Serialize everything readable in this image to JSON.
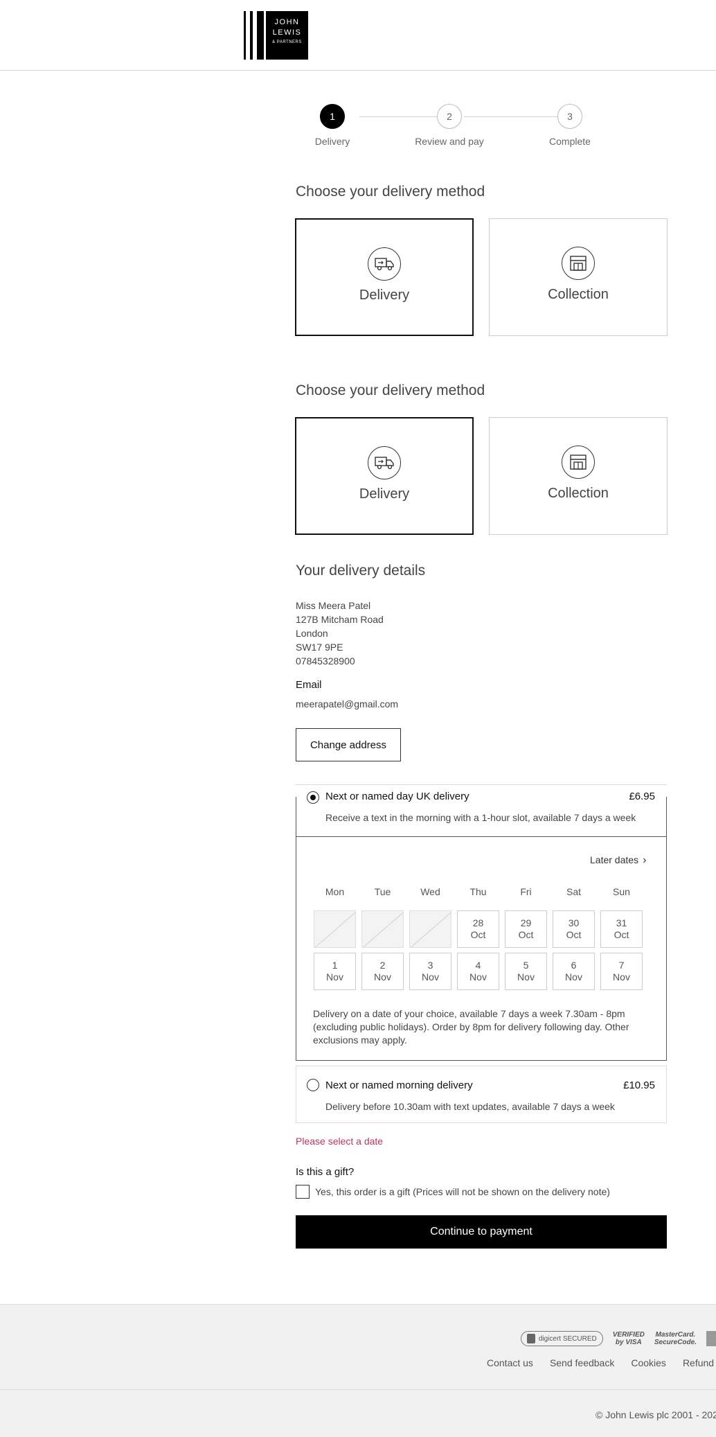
{
  "brand": {
    "line1": "JOHN",
    "line2": "LEWIS",
    "line3": "& PARTNERS"
  },
  "stepper": {
    "steps": [
      {
        "number": "1",
        "label": "Delivery",
        "active": true
      },
      {
        "number": "2",
        "label": "Review and pay",
        "active": false
      },
      {
        "number": "3",
        "label": "Complete",
        "active": false
      }
    ]
  },
  "method_section_1": {
    "title": "Choose your delivery method",
    "delivery_label": "Delivery",
    "collection_label": "Collection"
  },
  "method_section_2": {
    "title": "Choose your delivery method",
    "delivery_label": "Delivery",
    "collection_label": "Collection"
  },
  "icons": {
    "delivery": "delivery-van-icon",
    "collection": "store-icon",
    "later_dates": "chevron-right-icon"
  },
  "details": {
    "title": "Your delivery details",
    "name": "Miss Meera Patel",
    "street": "127B Mitcham Road",
    "city": "London",
    "postcode": "SW17 9PE",
    "phone": "07845328900",
    "email_heading": "Email",
    "email": "meerapatel@gmail.com",
    "change_button": "Change address"
  },
  "options": {
    "named_day": {
      "title": "Next or named day UK delivery",
      "price": "£6.95",
      "description": "Receive a text in the morning with a 1-hour slot, available 7 days a week",
      "selected": true
    },
    "morning": {
      "title": "Next or named morning delivery",
      "price": "£10.95",
      "description": "Delivery before 10.30am with text updates, available 7 days a week",
      "selected": false
    }
  },
  "calendar": {
    "later_dates": "Later dates",
    "weekdays": [
      "Mon",
      "Tue",
      "Wed",
      "Thu",
      "Fri",
      "Sat",
      "Sun"
    ],
    "week1": [
      {
        "day": "",
        "month": "",
        "disabled": true
      },
      {
        "day": "",
        "month": "",
        "disabled": true
      },
      {
        "day": "",
        "month": "",
        "disabled": true
      },
      {
        "day": "28",
        "month": "Oct",
        "disabled": false
      },
      {
        "day": "29",
        "month": "Oct",
        "disabled": false
      },
      {
        "day": "30",
        "month": "Oct",
        "disabled": false
      },
      {
        "day": "31",
        "month": "Oct",
        "disabled": false
      }
    ],
    "week2": [
      {
        "day": "1",
        "month": "Nov",
        "disabled": false
      },
      {
        "day": "2",
        "month": "Nov",
        "disabled": false
      },
      {
        "day": "3",
        "month": "Nov",
        "disabled": false
      },
      {
        "day": "4",
        "month": "Nov",
        "disabled": false
      },
      {
        "day": "5",
        "month": "Nov",
        "disabled": false
      },
      {
        "day": "6",
        "month": "Nov",
        "disabled": false
      },
      {
        "day": "7",
        "month": "Nov",
        "disabled": false
      }
    ],
    "note": "Delivery on a date of your choice, available 7 days a week 7.30am - 8pm (excluding public holidays). Order by 8pm for delivery following day. Other exclusions may apply."
  },
  "error": "Please select a date",
  "gift": {
    "heading": "Is this a gift?",
    "label": "Yes, this order is a gift (Prices will not be shown on the delivery note)"
  },
  "continue_button": "Continue to payment",
  "footer": {
    "badges": {
      "digicert": "digicert SECURED",
      "visa_line1": "VERIFIED",
      "visa_line2": "by VISA",
      "mc_line1": "MasterCard.",
      "mc_line2": "SecureCode."
    },
    "links": [
      "Contact us",
      "Send feedback",
      "Cookies",
      "Refund p"
    ],
    "copyright": "© John Lewis plc 2001 - 202"
  },
  "colors": {
    "primary": "#000000",
    "error": "#c0335a",
    "footer_bg": "#f1f1f1"
  }
}
